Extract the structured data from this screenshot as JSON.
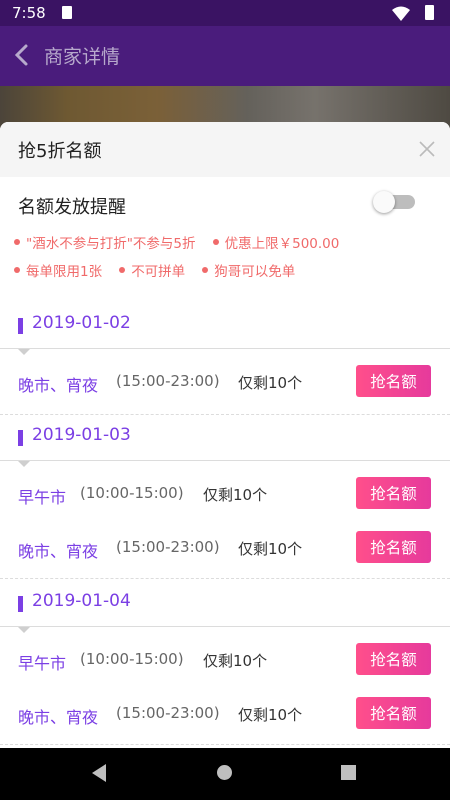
{
  "status_bar": {
    "time": "7:58"
  },
  "app_bar": {
    "title": "商家详情"
  },
  "sheet": {
    "title": "抢5折名额",
    "reminder_label": "名额发放提醒",
    "reminder_enabled": false,
    "rules": [
      "\"酒水不参与打折\"不参与5折",
      "优惠上限￥500.00",
      "每单限用1张",
      "不可拼单",
      "狗哥可以免单"
    ],
    "days": [
      {
        "date": "2019-01-02",
        "sessions": [
          {
            "name": "晚市、宵夜",
            "time": "(15:00-23:00)",
            "remaining": "仅剩10个",
            "button": "抢名额"
          }
        ]
      },
      {
        "date": "2019-01-03",
        "sessions": [
          {
            "name": "早午市",
            "time": "(10:00-15:00)",
            "remaining": "仅剩10个",
            "button": "抢名额"
          },
          {
            "name": "晚市、宵夜",
            "time": "(15:00-23:00)",
            "remaining": "仅剩10个",
            "button": "抢名额"
          }
        ]
      },
      {
        "date": "2019-01-04",
        "sessions": [
          {
            "name": "早午市",
            "time": "(10:00-15:00)",
            "remaining": "仅剩10个",
            "button": "抢名额"
          },
          {
            "name": "晚市、宵夜",
            "time": "(15:00-23:00)",
            "remaining": "仅剩10个",
            "button": "抢名额"
          }
        ]
      }
    ]
  },
  "colors": {
    "accent": "#7b3fe4",
    "rule_text": "#f06a6a",
    "button": "#ff4f8b",
    "app_bar": "#4a1c7c"
  }
}
